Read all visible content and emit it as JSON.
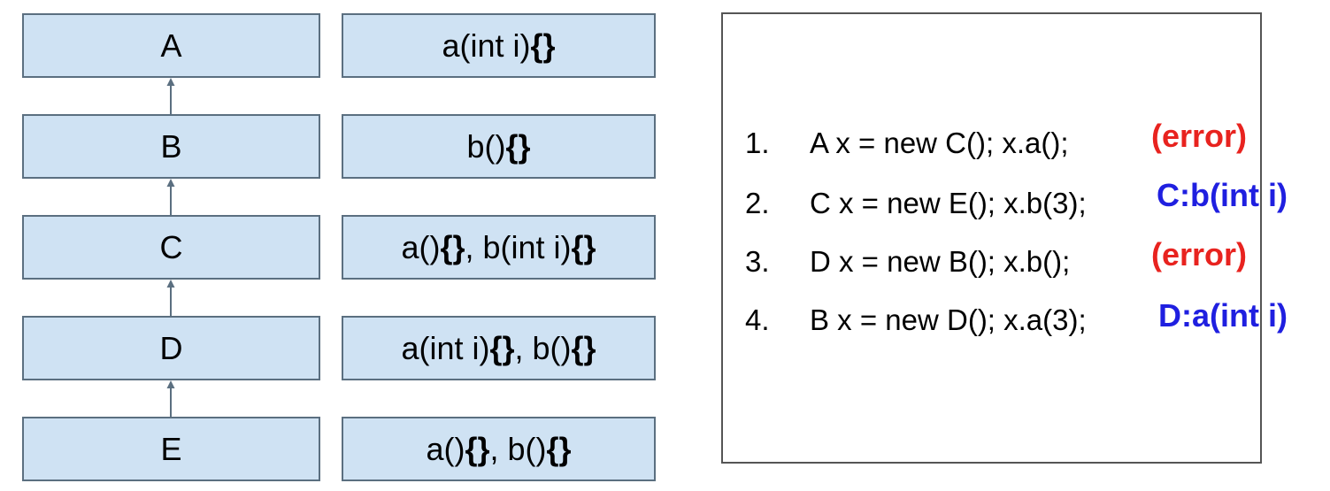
{
  "classes": [
    {
      "name": "A",
      "methods": [
        {
          "sig": "a(int i)"
        }
      ]
    },
    {
      "name": "B",
      "methods": [
        {
          "sig": "b()"
        }
      ]
    },
    {
      "name": "C",
      "methods": [
        {
          "sig": "a()"
        },
        {
          "sig": "b(int i)"
        }
      ]
    },
    {
      "name": "D",
      "methods": [
        {
          "sig": "a(int i)"
        },
        {
          "sig": "b()"
        }
      ]
    },
    {
      "name": "E",
      "methods": [
        {
          "sig": "a()"
        },
        {
          "sig": "b()"
        }
      ]
    }
  ],
  "braces": "{}",
  "separator": ", ",
  "questions": [
    {
      "number": "1.",
      "code": "A x = new C(); x.a();",
      "answer": "(error)",
      "answer_color": "#e8231f"
    },
    {
      "number": "2.",
      "code": "C x = new E(); x.b(3);",
      "answer": "C:b(int i)",
      "answer_color": "#1f1fe0"
    },
    {
      "number": "3.",
      "code": "D x = new B(); x.b();",
      "answer": "(error)",
      "answer_color": "#e8231f"
    },
    {
      "number": "4.",
      "code": "B x = new D(); x.a(3);",
      "answer": "D:a(int i)",
      "answer_color": "#1f1fe0"
    }
  ],
  "colors": {
    "box_fill": "#cfe2f3",
    "box_border": "#5b6f80",
    "arrow": "#5b6f80"
  }
}
